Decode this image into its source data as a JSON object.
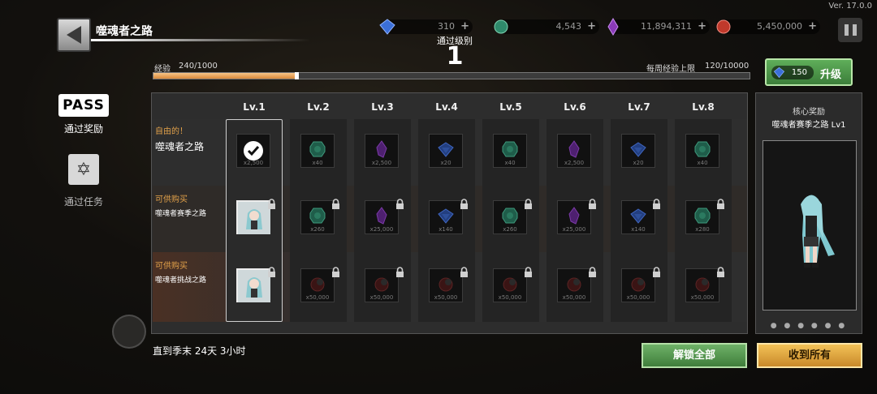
{
  "version": "Ver. 17.0.0",
  "header": {
    "title": "噬魂者之路",
    "currencies": [
      {
        "name": "gem",
        "value": "310",
        "color": "#3b6fd8"
      },
      {
        "name": "essence",
        "value": "4,543",
        "color": "#2f8a6b"
      },
      {
        "name": "soul",
        "value": "11,894,311",
        "color": "#8a3ab8"
      },
      {
        "name": "fire",
        "value": "5,450,000",
        "color": "#c0392b"
      }
    ]
  },
  "pass_level": {
    "label": "通过级别",
    "value": "1"
  },
  "exp": {
    "label": "经验",
    "value": "240/1000",
    "progress": 0.24,
    "weekly_label": "每周经验上限",
    "weekly_value": "120/10000"
  },
  "upgrade": {
    "cost": "150",
    "label": "升级"
  },
  "sidebar": [
    {
      "label": "PASS",
      "caption": "通过奖励"
    },
    {
      "caption": "通过任务"
    }
  ],
  "rows": [
    {
      "tag": "自由的！",
      "name": "噬魂者之路"
    },
    {
      "tag": "可供购买",
      "name": "噬魂者赛季之路"
    },
    {
      "tag": "可供购买",
      "name": "噬魂者挑战之路"
    }
  ],
  "levels": [
    "Lv.1",
    "Lv.2",
    "Lv.3",
    "Lv.4",
    "Lv.5",
    "Lv.6",
    "Lv.7",
    "Lv.8"
  ],
  "rewards": {
    "row1": [
      {
        "icon": "check-icon",
        "qty": "x2,500"
      },
      {
        "icon": "green-orb-icon",
        "qty": "x40"
      },
      {
        "icon": "purple-crystal-icon",
        "qty": "x2,500"
      },
      {
        "icon": "blue-gem-icon",
        "qty": "x20"
      },
      {
        "icon": "green-orb-icon",
        "qty": "x40"
      },
      {
        "icon": "purple-crystal-icon",
        "qty": "x2,500"
      },
      {
        "icon": "blue-gem-icon",
        "qty": "x20"
      },
      {
        "icon": "green-orb-icon",
        "qty": "x40"
      }
    ],
    "row2": [
      {
        "icon": "character-icon",
        "qty": ""
      },
      {
        "icon": "green-orb-icon",
        "qty": "x260"
      },
      {
        "icon": "purple-crystal-icon",
        "qty": "x25,000"
      },
      {
        "icon": "blue-gem-icon",
        "qty": "x140"
      },
      {
        "icon": "green-orb-icon",
        "qty": "x260"
      },
      {
        "icon": "purple-crystal-icon",
        "qty": "x25,000"
      },
      {
        "icon": "blue-gem-icon",
        "qty": "x140"
      },
      {
        "icon": "green-orb-icon",
        "qty": "x280"
      }
    ],
    "row3": [
      {
        "icon": "character-icon",
        "qty": ""
      },
      {
        "icon": "red-relic-icon",
        "qty": "x50,000"
      },
      {
        "icon": "red-relic-icon",
        "qty": "x50,000"
      },
      {
        "icon": "red-relic-icon",
        "qty": "x50,000"
      },
      {
        "icon": "red-relic-icon",
        "qty": "x50,000"
      },
      {
        "icon": "red-relic-icon",
        "qty": "x50,000"
      },
      {
        "icon": "red-relic-icon",
        "qty": "x50,000"
      },
      {
        "icon": "red-relic-icon",
        "qty": "x50,000"
      }
    ]
  },
  "countdown": "直到季末 24天 3小时",
  "buttons": {
    "unlock_all": "解锁全部",
    "collect_all": "收到所有"
  },
  "core_reward": {
    "title": "核心奖励",
    "subtitle": "噬魂者赛季之路 Lv1",
    "pager": "● ● ● ● ● ●"
  }
}
